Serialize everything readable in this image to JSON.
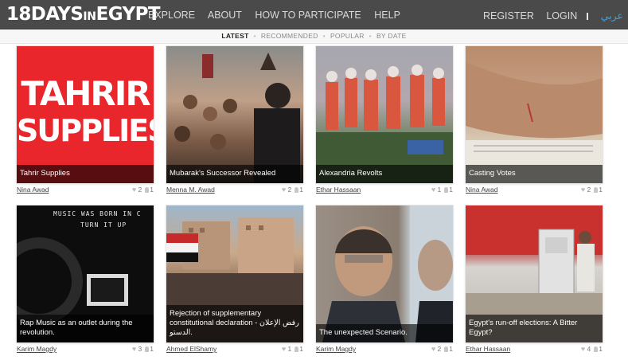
{
  "site": {
    "logo_main": "18DAYS",
    "logo_small": "IN",
    "logo_tail": "EGYPT"
  },
  "nav": {
    "left": [
      "EXPLORE",
      "ABOUT",
      "HOW TO PARTICIPATE",
      "HELP"
    ],
    "register": "REGISTER",
    "login": "LOGIN",
    "language": "عربي"
  },
  "subnav": {
    "items": [
      "LATEST",
      "RECOMMENDED",
      "POPULAR",
      "BY DATE"
    ],
    "separator": "•",
    "active": "LATEST"
  },
  "cards": [
    {
      "caption": "Tahrir Supplies",
      "author": "Nina Awad",
      "likes": "2",
      "contributors": "1",
      "thumb_text_1": "TAHRIR",
      "thumb_text_2": "SUPPLIES"
    },
    {
      "caption": "Mubarak's Successor Revealed",
      "author": "Menna M. Awad",
      "likes": "2",
      "contributors": "1"
    },
    {
      "caption": "Alexandria Revolts",
      "author": "Ethar Hassaan",
      "likes": "1",
      "contributors": "1"
    },
    {
      "caption": "Casting Votes",
      "author": "Nina Awad",
      "likes": "2",
      "contributors": "1"
    },
    {
      "caption": "Rap Music as an outlet during the revolution.",
      "author": "Karim Magdy",
      "likes": "3",
      "contributors": "1",
      "thumb_text_1": "MUSIC WAS BORN IN C",
      "thumb_text_2": "TURN IT UP"
    },
    {
      "caption": "Rejection of supplementary constitutional declaration - رفض الإعلان الدستو.",
      "author": "Ahmed ElShamy",
      "likes": "1",
      "contributors": "1"
    },
    {
      "caption": "The unexpected Scenario.",
      "author": "Karim Magdy",
      "likes": "2",
      "contributors": "1"
    },
    {
      "caption": "Egypt's run-off elections: A Bitter Egypt?",
      "author": "Ethar Hassaan",
      "likes": "4",
      "contributors": "1"
    }
  ],
  "icons": {
    "heart": "heart-icon",
    "person": "person-icon"
  },
  "colors": {
    "topbar": "#4a4a4a",
    "arabic_link": "#4a9fd8",
    "tahrir_red": "#e8262b"
  }
}
